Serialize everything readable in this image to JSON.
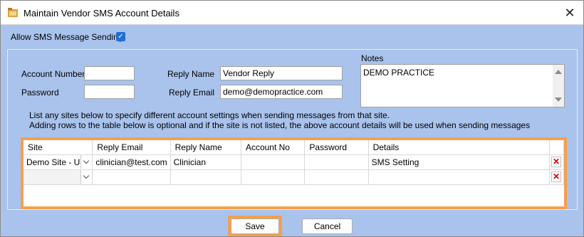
{
  "window": {
    "title": "Maintain Vendor SMS Account Details",
    "close_glyph": "✕"
  },
  "allow_sms": {
    "label": "Allow SMS Message Sending",
    "checked": true,
    "check_glyph": "✓"
  },
  "account": {
    "account_number_label": "Account Number",
    "account_number_value": "",
    "password_label": "Password",
    "password_value": "",
    "reply_name_label": "Reply Name",
    "reply_name_value": "Vendor Reply",
    "reply_email_label": "Reply Email",
    "reply_email_value": "demo@demopractice.com"
  },
  "notes": {
    "label": "Notes",
    "value": "DEMO PRACTICE"
  },
  "info": {
    "line1": "List any sites below to specify different account settings when sending messages from that site.",
    "line2": "Adding rows to the table below is optional and if the site is not listed, the above account details will be used when sending messages"
  },
  "table": {
    "headers": [
      "Site",
      "Reply Email",
      "Reply Name",
      "Account No",
      "Password",
      "Details"
    ],
    "rows": [
      {
        "site": "Demo Site - UK",
        "reply_email": "clinician@test.com",
        "reply_name": "Clinician",
        "account_no": "",
        "password": "",
        "details": "SMS Setting"
      },
      {
        "site": "",
        "reply_email": "",
        "reply_name": "",
        "account_no": "",
        "password": "",
        "details": ""
      }
    ],
    "delete_glyph": "✕"
  },
  "buttons": {
    "save": "Save",
    "cancel": "Cancel"
  },
  "colors": {
    "background": "#a9c3ec",
    "highlight": "#f5a04b",
    "checkbox": "#1f6fd0",
    "delete": "#d00000"
  },
  "icons": {
    "app": "folder-icon",
    "close": "close-icon",
    "dropdown": "chevron-down-icon",
    "delete": "delete-icon"
  }
}
